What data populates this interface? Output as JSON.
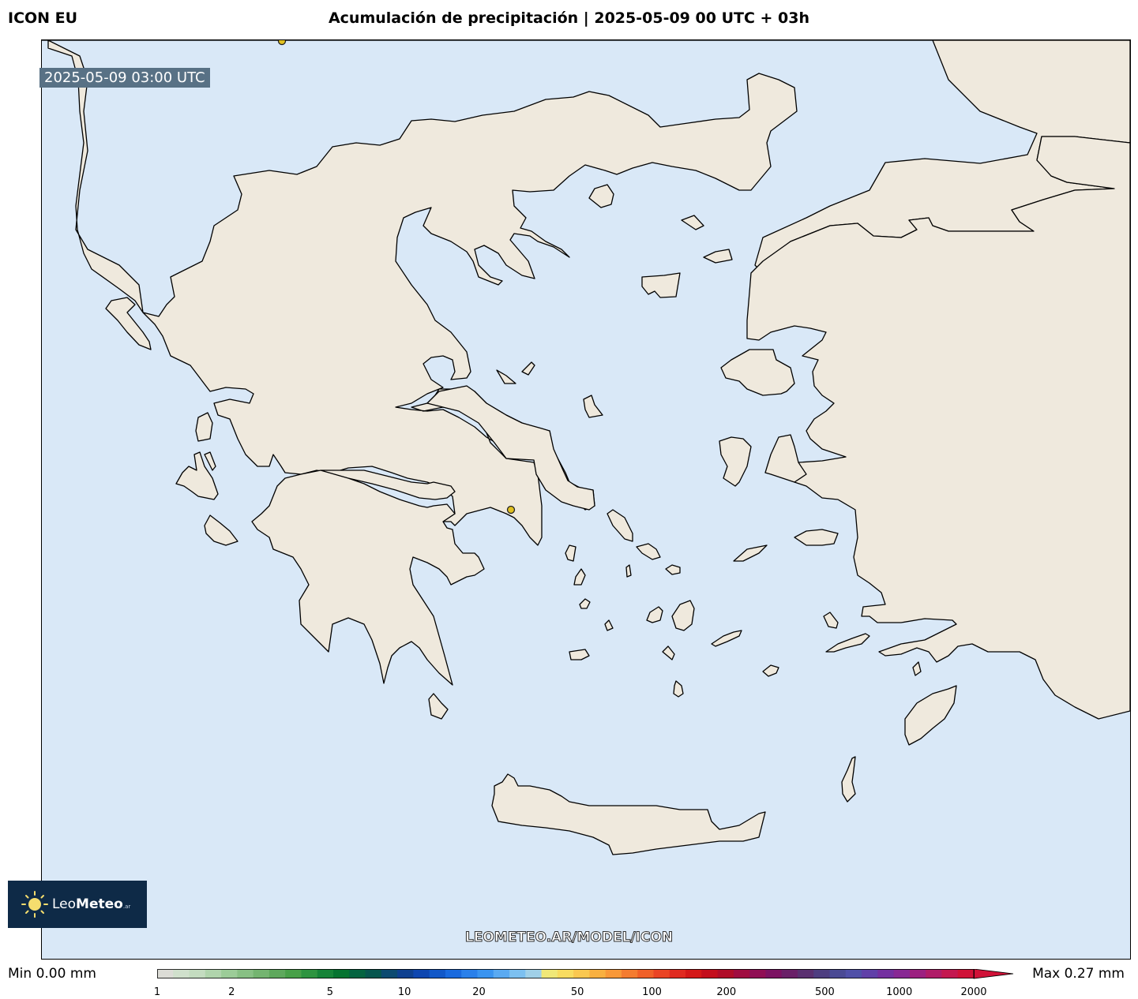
{
  "header": {
    "model": "ICON EU",
    "title": "Acumulación de precipitación | 2025-05-09 00 UTC + 03h"
  },
  "map": {
    "valid_time": "2025-05-09 03:00 UTC",
    "region": "Greece / Aegean Sea",
    "sea_color": "#d9e8f7",
    "land_color": "#efe9dd",
    "coast_color": "#000000",
    "precipitation_shown": "none (all below 1 mm)",
    "markers": [
      {
        "name": "city-marker-north",
        "color": "#e0c020"
      },
      {
        "name": "city-marker-athens",
        "color": "#e0c020"
      }
    ]
  },
  "branding": {
    "logo_text_regular": "Leo",
    "logo_text_bold": "Meteo",
    "logo_suffix": ".ar",
    "url": "LEOMETEO.AR/MODEL/ICON"
  },
  "legend": {
    "min_label": "Min 0.00 mm",
    "max_label": "Max 0.27 mm",
    "ticks": [
      "1",
      "2",
      "5",
      "10",
      "20",
      "50",
      "100",
      "200",
      "500",
      "1000",
      "2000"
    ],
    "colors": [
      "#dcdcd6",
      "#d0e0cc",
      "#c4dcc0",
      "#b0d4ac",
      "#9ccc98",
      "#88c084",
      "#74b470",
      "#5ea85c",
      "#48a048",
      "#2e9440",
      "#168438",
      "#067430",
      "#046440",
      "#06564e",
      "#0c4a70",
      "#0e4090",
      "#0e46b0",
      "#1258c8",
      "#1a6ade",
      "#2a80ea",
      "#3a94f0",
      "#5aaaf2",
      "#7cc0f0",
      "#a0d0e8",
      "#f0e878",
      "#f8dc60",
      "#fac850",
      "#f8b040",
      "#f89838",
      "#f47c30",
      "#f06028",
      "#ea4424",
      "#e02a20",
      "#d41818",
      "#c40e1c",
      "#b00c28",
      "#a00c40",
      "#900e54",
      "#7c1262",
      "#6a2068",
      "#5a3070",
      "#4e3e80",
      "#4a4a94",
      "#5050a8",
      "#6040a8",
      "#7430a0",
      "#882894",
      "#9c2080",
      "#b01c68",
      "#c41850",
      "#d01238"
    ]
  }
}
